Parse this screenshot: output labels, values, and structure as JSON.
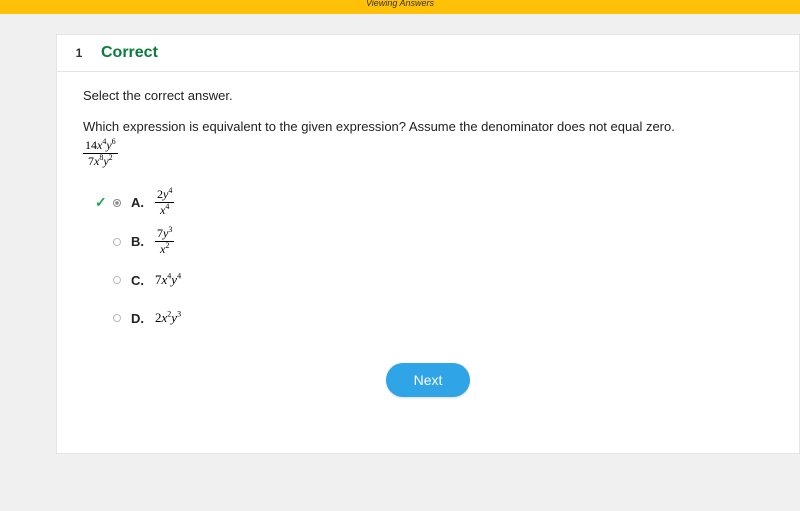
{
  "header": {
    "title": "Viewing Answers"
  },
  "question": {
    "number": "1",
    "status": "Correct",
    "instruction": "Select the correct answer.",
    "prompt": "Which expression is equivalent to the given expression? Assume the denominator does not equal zero.",
    "given_expression": {
      "numerator": {
        "coef": "14",
        "v1": "x",
        "e1": "4",
        "v2": "y",
        "e2": "6"
      },
      "denominator": {
        "coef": "7",
        "v1": "x",
        "e1": "8",
        "v2": "y",
        "e2": "2"
      }
    },
    "options": [
      {
        "letter": "A.",
        "correct": true,
        "selected": true,
        "type": "fraction",
        "numerator": {
          "coef": "2",
          "v1": "y",
          "e1": "4"
        },
        "denominator": {
          "coef": "",
          "v1": "x",
          "e1": "4"
        }
      },
      {
        "letter": "B.",
        "correct": false,
        "selected": false,
        "type": "fraction",
        "numerator": {
          "coef": "7",
          "v1": "y",
          "e1": "3"
        },
        "denominator": {
          "coef": "",
          "v1": "x",
          "e1": "2"
        }
      },
      {
        "letter": "C.",
        "correct": false,
        "selected": false,
        "type": "plain",
        "expr": {
          "coef": "7",
          "v1": "x",
          "e1": "4",
          "v2": "y",
          "e2": "4"
        }
      },
      {
        "letter": "D.",
        "correct": false,
        "selected": false,
        "type": "plain",
        "expr": {
          "coef": "2",
          "v1": "x",
          "e1": "2",
          "v2": "y",
          "e2": "3"
        }
      }
    ]
  },
  "buttons": {
    "next": "Next"
  }
}
